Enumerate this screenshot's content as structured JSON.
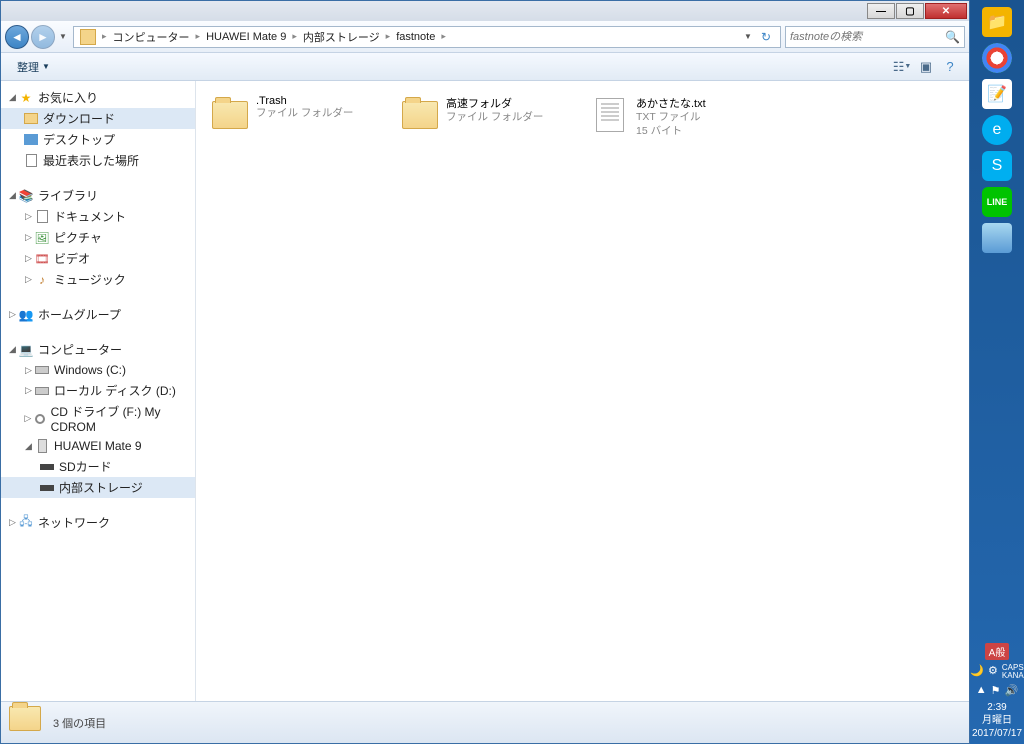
{
  "breadcrumb": {
    "items": [
      "コンピューター",
      "HUAWEI Mate 9",
      "内部ストレージ",
      "fastnote"
    ]
  },
  "search": {
    "placeholder": "fastnoteの検索"
  },
  "toolbar": {
    "organize": "整理"
  },
  "sidebar": {
    "favorites": {
      "label": "お気に入り",
      "items": [
        "ダウンロード",
        "デスクトップ",
        "最近表示した場所"
      ]
    },
    "libraries": {
      "label": "ライブラリ",
      "items": [
        "ドキュメント",
        "ピクチャ",
        "ビデオ",
        "ミュージック"
      ]
    },
    "homegroup": {
      "label": "ホームグループ"
    },
    "computer": {
      "label": "コンピューター",
      "items": [
        "Windows (C:)",
        "ローカル ディスク (D:)",
        "CD ドライブ (F:) My CDROM",
        "HUAWEI Mate 9"
      ],
      "phone_children": [
        "SDカード",
        "内部ストレージ"
      ]
    },
    "network": {
      "label": "ネットワーク"
    }
  },
  "files": [
    {
      "name": ".Trash",
      "type": "folder",
      "meta": "ファイル フォルダー"
    },
    {
      "name": "高速フォルダ",
      "type": "folder",
      "meta": "ファイル フォルダー"
    },
    {
      "name": "あかさたな.txt",
      "type": "txt",
      "meta1": "TXT ファイル",
      "meta2": "15 バイト"
    }
  ],
  "status": {
    "count": "3 個の項目"
  },
  "tray": {
    "ime": "A般",
    "caps": "CAPS",
    "kana": "KANA",
    "time": "2:39",
    "day": "月曜日",
    "date": "2017/07/17",
    "line": "LINE"
  }
}
